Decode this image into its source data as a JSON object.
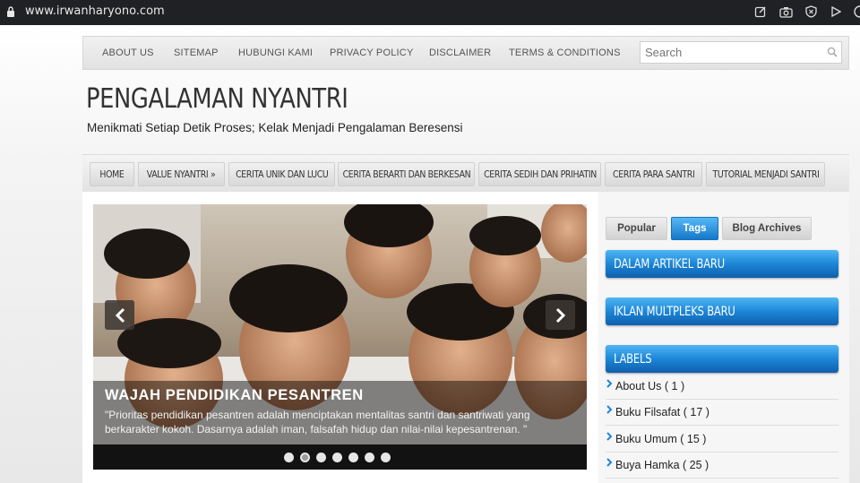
{
  "browser": {
    "url": "www.irwanharyono.com",
    "icons": [
      "edit-icon",
      "camera-icon",
      "shield-icon",
      "play-icon",
      "circle-icon"
    ]
  },
  "top_menu": {
    "items": [
      "ABOUT US",
      "SITEMAP",
      "HUBUNGI KAMI",
      "PRIVACY POLICY",
      "DISCLAIMER",
      "TERMS & CONDITIONS"
    ],
    "search_placeholder": "Search"
  },
  "header": {
    "title": "PENGALAMAN NYANTRI",
    "description": "Menikmati Setiap Detik Proses; Kelak Menjadi Pengalaman Beresensi"
  },
  "main_nav": {
    "items": [
      "HOME",
      "VALUE NYANTRI  »",
      "CERITA UNIK DAN LUCU",
      "CERITA BERARTI DAN BERKESAN",
      "CERITA SEDIH DAN PRIHATIN",
      "CERITA PARA SANTRI",
      "TUTORIAL MENJADI SANTRI"
    ]
  },
  "slider": {
    "title": "WAJAH PENDIDIKAN PESANTREN",
    "text": "\"Prioritas pendidikan pesantren adalah menciptakan mentalitas santri dan santriwati yang berkarakter kokoh. Dasarnya adalah iman, falsafah hidup dan nilai-nilai kepesantrenan. \"",
    "dot_count": 7,
    "active_dot": 2
  },
  "sidebar": {
    "tabs": [
      "Popular",
      "Tags",
      "Blog Archives"
    ],
    "active_tab": "Tags",
    "widgets": [
      "DALAM ARTIKEL BARU",
      "IKLAN MULTPLEKS BARU",
      "LABELS"
    ],
    "labels": [
      "About Us ( 1 )",
      "Buku Filsafat ( 17 )",
      "Buku Umum ( 15 )",
      "Buya Hamka ( 25 )"
    ]
  },
  "colors": {
    "accent_blue": "#1d86d6",
    "browser_bar": "#202124"
  }
}
